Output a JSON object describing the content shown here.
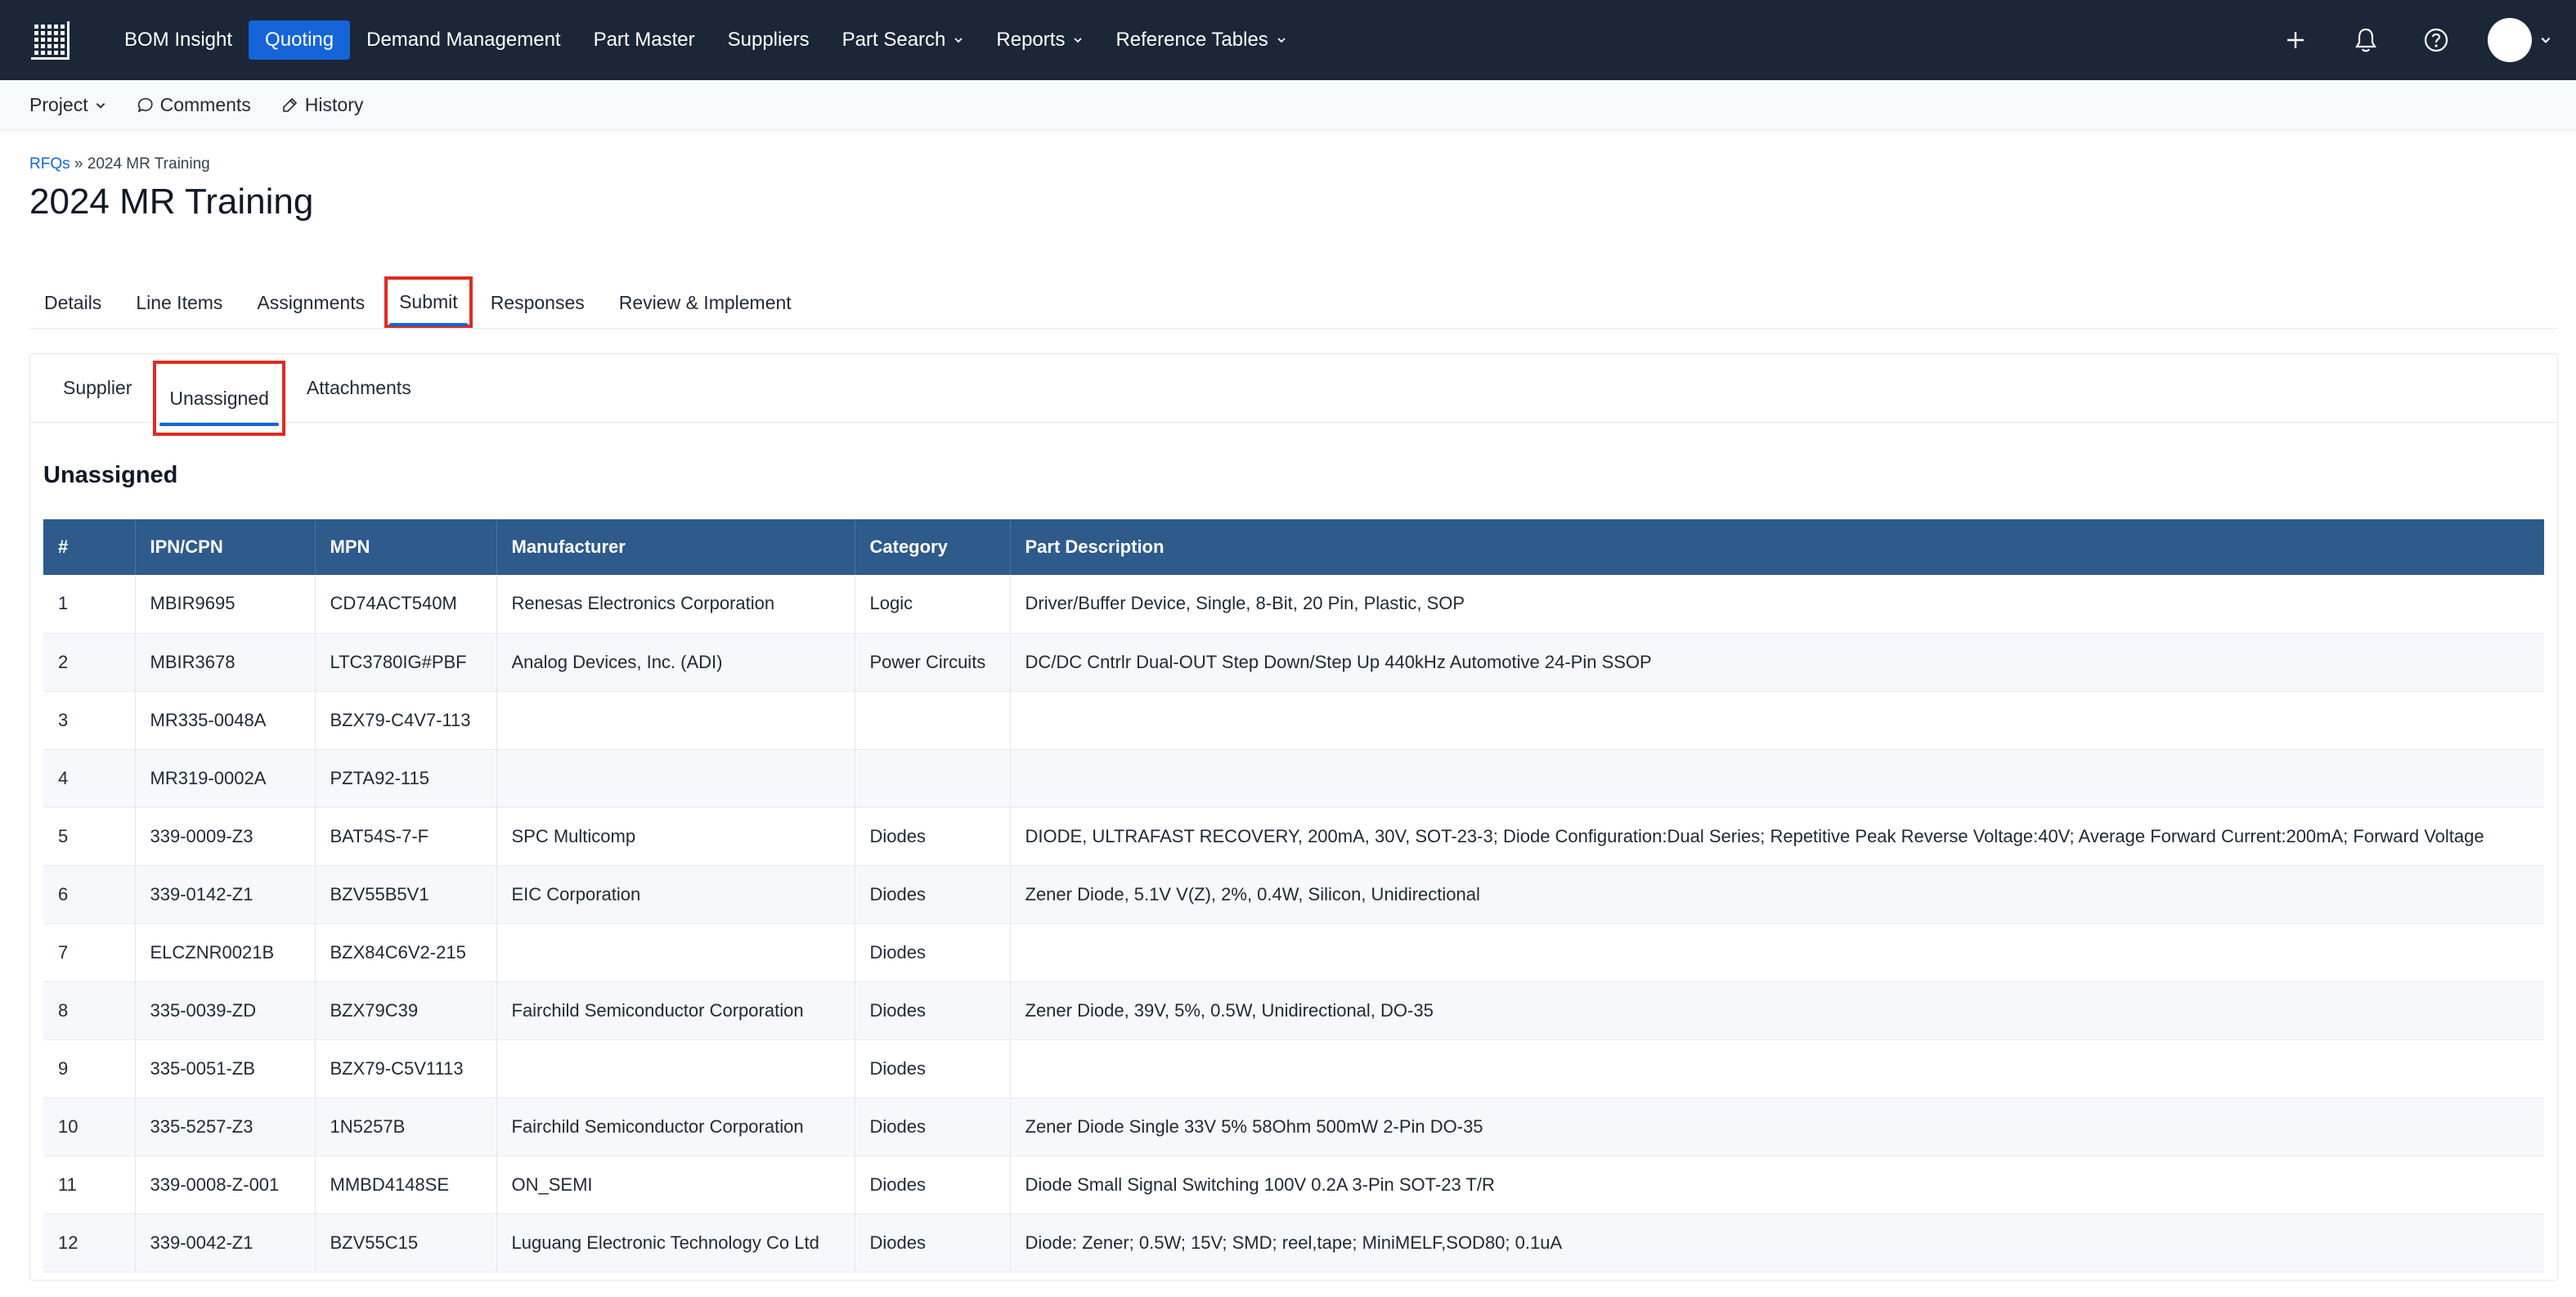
{
  "topnav": {
    "items": [
      {
        "label": "BOM Insight",
        "dropdown": false,
        "active": false
      },
      {
        "label": "Quoting",
        "dropdown": false,
        "active": true
      },
      {
        "label": "Demand Management",
        "dropdown": false,
        "active": false
      },
      {
        "label": "Part Master",
        "dropdown": false,
        "active": false
      },
      {
        "label": "Suppliers",
        "dropdown": false,
        "active": false
      },
      {
        "label": "Part Search",
        "dropdown": true,
        "active": false
      },
      {
        "label": "Reports",
        "dropdown": true,
        "active": false
      },
      {
        "label": "Reference Tables",
        "dropdown": true,
        "active": false
      }
    ],
    "icons": [
      "plus-icon",
      "bell-icon",
      "help-icon"
    ],
    "colors": {
      "bg": "#1b2637",
      "active": "#1565d8"
    }
  },
  "subbar": {
    "project_label": "Project",
    "comments_label": "Comments",
    "history_label": "History"
  },
  "breadcrumb": {
    "link": "RFQs",
    "separator": "»",
    "current": "2024 MR Training"
  },
  "page": {
    "title": "2024 MR Training"
  },
  "tabs": [
    {
      "label": "Details",
      "active": false
    },
    {
      "label": "Line Items",
      "active": false
    },
    {
      "label": "Assignments",
      "active": false
    },
    {
      "label": "Submit",
      "active": true
    },
    {
      "label": "Responses",
      "active": false
    },
    {
      "label": "Review & Implement",
      "active": false
    }
  ],
  "subtabs": [
    {
      "label": "Supplier",
      "active": false
    },
    {
      "label": "Unassigned",
      "active": true
    },
    {
      "label": "Attachments",
      "active": false
    }
  ],
  "section": {
    "title": "Unassigned"
  },
  "table": {
    "headers": [
      "#",
      "IPN/CPN",
      "MPN",
      "Manufacturer",
      "Category",
      "Part Description"
    ],
    "rows": [
      [
        "1",
        "MBIR9695",
        "CD74ACT540M",
        "Renesas Electronics Corporation",
        "Logic",
        "Driver/Buffer Device, Single, 8-Bit, 20 Pin, Plastic, SOP"
      ],
      [
        "2",
        "MBIR3678",
        "LTC3780IG#PBF",
        "Analog Devices, Inc. (ADI)",
        "Power Circuits",
        "DC/DC Cntrlr Dual-OUT Step Down/Step Up 440kHz Automotive 24-Pin SSOP"
      ],
      [
        "3",
        "MR335-0048A",
        "BZX79-C4V7-113",
        "",
        "",
        ""
      ],
      [
        "4",
        "MR319-0002A",
        "PZTA92-115",
        "",
        "",
        ""
      ],
      [
        "5",
        "339-0009-Z3",
        "BAT54S-7-F",
        "SPC Multicomp",
        "Diodes",
        "DIODE, ULTRAFAST RECOVERY, 200mA, 30V, SOT-23-3; Diode Configuration:Dual Series; Repetitive Peak Reverse Voltage:40V; Average Forward Current:200mA; Forward Voltage"
      ],
      [
        "6",
        "339-0142-Z1",
        "BZV55B5V1",
        "EIC Corporation",
        "Diodes",
        "Zener Diode, 5.1V V(Z), 2%, 0.4W, Silicon, Unidirectional"
      ],
      [
        "7",
        "ELCZNR0021B",
        "BZX84C6V2-215",
        "",
        "Diodes",
        ""
      ],
      [
        "8",
        "335-0039-ZD",
        "BZX79C39",
        "Fairchild Semiconductor Corporation",
        "Diodes",
        "Zener Diode, 39V, 5%, 0.5W, Unidirectional, DO-35"
      ],
      [
        "9",
        "335-0051-ZB",
        "BZX79-C5V1113",
        "",
        "Diodes",
        ""
      ],
      [
        "10",
        "335-5257-Z3",
        "1N5257B",
        "Fairchild Semiconductor Corporation",
        "Diodes",
        "Zener Diode Single 33V 5% 58Ohm 500mW 2-Pin DO-35"
      ],
      [
        "11",
        "339-0008-Z-001",
        "MMBD4148SE",
        "ON_SEMI",
        "Diodes",
        "Diode Small Signal Switching 100V 0.2A 3-Pin SOT-23 T/R"
      ],
      [
        "12",
        "339-0042-Z1",
        "BZV55C15",
        "Luguang Electronic Technology Co Ltd",
        "Diodes",
        "Diode: Zener; 0.5W; 15V; SMD; reel,tape; MiniMELF,SOD80; 0.1uA"
      ]
    ],
    "header_color": "#2e5a8c"
  },
  "highlight_color": "#e02b20"
}
